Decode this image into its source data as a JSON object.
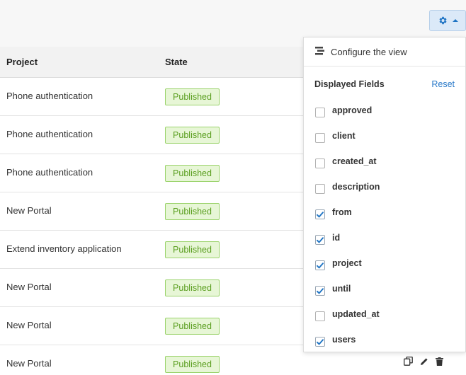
{
  "toolbar": {
    "settings_icon": "gear-icon",
    "caret_icon": "caret-up-icon",
    "accent": "#1f74c4"
  },
  "table": {
    "headers": {
      "project": "Project",
      "state": "State"
    },
    "rows": [
      {
        "project": "Phone authentication",
        "state": "Published"
      },
      {
        "project": "Phone authentication",
        "state": "Published"
      },
      {
        "project": "Phone authentication",
        "state": "Published"
      },
      {
        "project": "New Portal",
        "state": "Published"
      },
      {
        "project": "Extend inventory application",
        "state": "Published"
      },
      {
        "project": "New Portal",
        "state": "Published"
      },
      {
        "project": "New Portal",
        "state": "Published"
      },
      {
        "project": "New Portal",
        "state": "Published"
      }
    ],
    "row_actions": [
      "copy-icon",
      "edit-icon",
      "trash-icon"
    ],
    "status_colors": {
      "bg": "#e7f6d6",
      "border": "#9bd36c",
      "text": "#5a9e1f"
    }
  },
  "panel": {
    "header_label": "Configure the view",
    "header_icon": "configure-view-icon",
    "subtitle": "Displayed Fields",
    "reset_label": "Reset",
    "fields": [
      {
        "label": "approved",
        "checked": false
      },
      {
        "label": "client",
        "checked": false
      },
      {
        "label": "created_at",
        "checked": false
      },
      {
        "label": "description",
        "checked": false
      },
      {
        "label": "from",
        "checked": true
      },
      {
        "label": "id",
        "checked": true
      },
      {
        "label": "project",
        "checked": true
      },
      {
        "label": "until",
        "checked": true
      },
      {
        "label": "updated_at",
        "checked": false
      },
      {
        "label": "users",
        "checked": true
      }
    ]
  }
}
